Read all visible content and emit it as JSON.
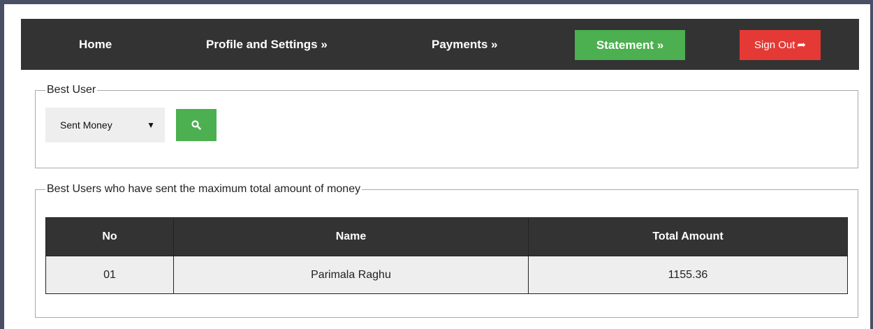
{
  "nav": {
    "home": "Home",
    "profile": "Profile and Settings »",
    "payments": "Payments »",
    "statement": "Statement »",
    "signout": "Sign Out",
    "signout_icon": "sign-out-icon"
  },
  "colors": {
    "navbar": "#333333",
    "statement_button": "#4caf50",
    "signout_button": "#e53935",
    "search_button": "#4caf50"
  },
  "best_user": {
    "legend": "Best User",
    "select_value": "Sent Money",
    "search_icon": "search-icon"
  },
  "results": {
    "legend": "Best Users who have sent the maximum total amount of money",
    "headers": [
      "No",
      "Name",
      "Total Amount"
    ],
    "rows": [
      {
        "no": "01",
        "name": "Parimala Raghu",
        "total": "1155.36"
      }
    ]
  }
}
